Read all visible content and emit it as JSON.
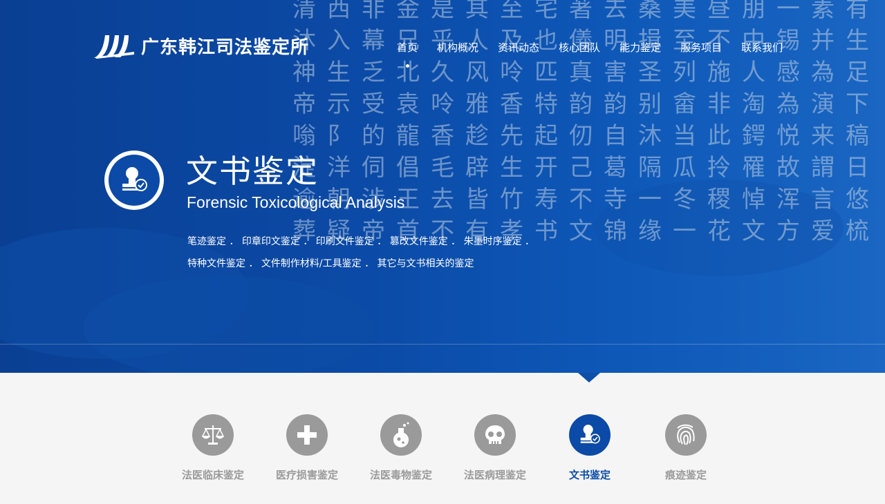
{
  "brand": {
    "name": "广东韩江司法鉴定所"
  },
  "nav": {
    "items": [
      {
        "label": "首页"
      },
      {
        "label": "机构概况"
      },
      {
        "label": "资讯动态"
      },
      {
        "label": "核心团队"
      },
      {
        "label": "能力鉴定"
      },
      {
        "label": "服务项目"
      },
      {
        "label": "联系我们"
      }
    ],
    "active_index": 0
  },
  "hero": {
    "title": "文书鉴定",
    "subtitle": "Forensic Toxicological Analysis",
    "desc_line1": "笔迹鉴定 ． 印章印文鉴定 ． 印刷文件鉴定 ． 篡改文件鉴定 ． 朱墨时序鉴定 ．",
    "desc_line2": "特种文件鉴定 ． 文件制作材料/工具鉴定 ． 其它与文书相关的鉴定",
    "icon": "document-stamp-icon"
  },
  "categories": [
    {
      "label": "法医临床鉴定",
      "icon": "scales-icon"
    },
    {
      "label": "医疗损害鉴定",
      "icon": "medical-cross-icon"
    },
    {
      "label": "法医毒物鉴定",
      "icon": "flask-icon"
    },
    {
      "label": "法医病理鉴定",
      "icon": "skull-icon"
    },
    {
      "label": "文书鉴定",
      "icon": "document-stamp-icon"
    },
    {
      "label": "痕迹鉴定",
      "icon": "fingerprint-icon"
    }
  ],
  "active_category": 4,
  "colors": {
    "primary": "#0b4aa6",
    "inactive": "#9a9a9a",
    "background": "#f5f5f5"
  }
}
